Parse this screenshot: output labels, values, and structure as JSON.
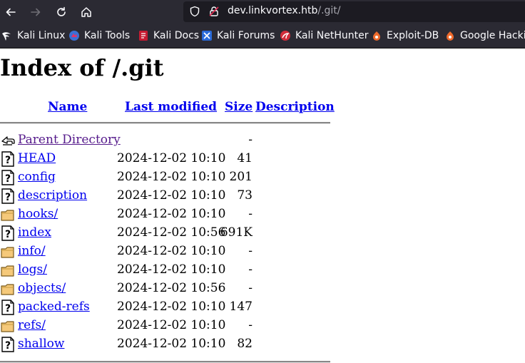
{
  "browser": {
    "url_host": "dev.linkvortex.htb",
    "url_path": "/.git/",
    "bookmarks": [
      {
        "label": "Kali Linux",
        "icon": "kali-dragon-icon"
      },
      {
        "label": "Kali Tools",
        "icon": "kali-tools-icon"
      },
      {
        "label": "Kali Docs",
        "icon": "kali-docs-icon"
      },
      {
        "label": "Kali Forums",
        "icon": "kali-forums-icon"
      },
      {
        "label": "Kali NetHunter",
        "icon": "nethunter-icon"
      },
      {
        "label": "Exploit-DB",
        "icon": "exploit-db-icon"
      },
      {
        "label": "Google Hacking DB",
        "icon": "ghdb-icon"
      }
    ]
  },
  "page": {
    "title": "Index of /.git",
    "columns": {
      "name": "Name",
      "modified": "Last modified",
      "size": "Size",
      "description": "Description"
    },
    "parent": {
      "name": "Parent Directory",
      "size": "-"
    },
    "entries": [
      {
        "name": "HEAD",
        "modified": "2024-12-02 10:10",
        "size": "41",
        "type": "file"
      },
      {
        "name": "config",
        "modified": "2024-12-02 10:10",
        "size": "201",
        "type": "file"
      },
      {
        "name": "description",
        "modified": "2024-12-02 10:10",
        "size": "73",
        "type": "file"
      },
      {
        "name": "hooks/",
        "modified": "2024-12-02 10:10",
        "size": "-",
        "type": "folder"
      },
      {
        "name": "index",
        "modified": "2024-12-02 10:56",
        "size": "691K",
        "type": "file"
      },
      {
        "name": "info/",
        "modified": "2024-12-02 10:10",
        "size": "-",
        "type": "folder"
      },
      {
        "name": "logs/",
        "modified": "2024-12-02 10:10",
        "size": "-",
        "type": "folder"
      },
      {
        "name": "objects/",
        "modified": "2024-12-02 10:56",
        "size": "-",
        "type": "folder"
      },
      {
        "name": "packed-refs",
        "modified": "2024-12-02 10:10",
        "size": "147",
        "type": "file"
      },
      {
        "name": "refs/",
        "modified": "2024-12-02 10:10",
        "size": "-",
        "type": "folder"
      },
      {
        "name": "shallow",
        "modified": "2024-12-02 10:10",
        "size": "82",
        "type": "file"
      }
    ]
  }
}
